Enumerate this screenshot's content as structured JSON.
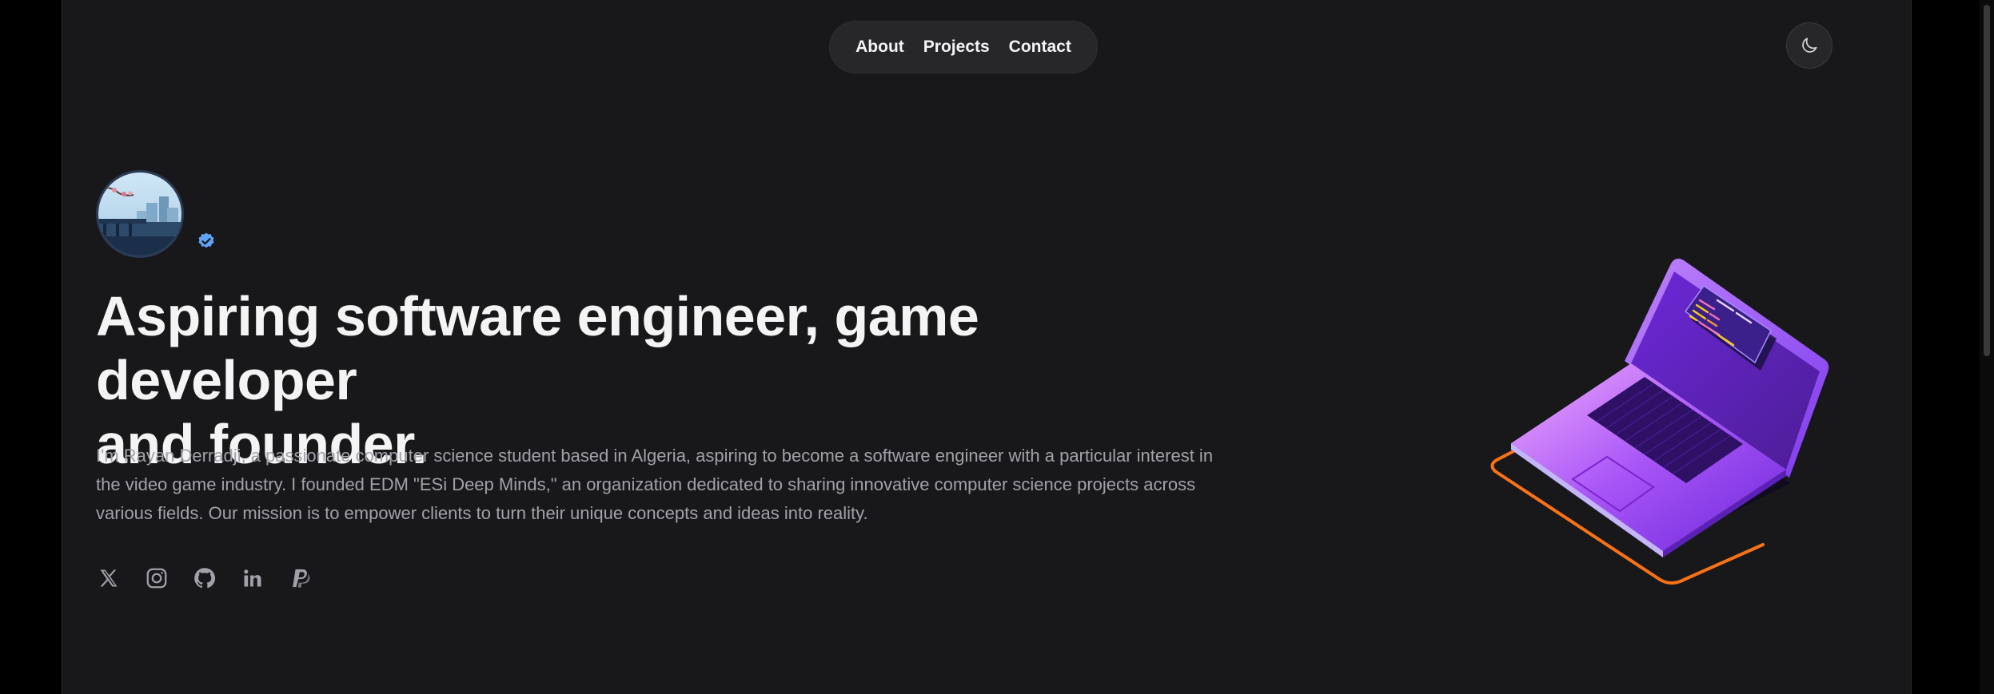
{
  "nav": {
    "items": [
      {
        "label": "About"
      },
      {
        "label": "Projects"
      },
      {
        "label": "Contact"
      }
    ]
  },
  "theme_toggle": {
    "icon": "moon-icon"
  },
  "hero": {
    "headline_line1": "Aspiring software engineer, game developer",
    "headline_line2": "and founder.",
    "bio": "I'm Rayan Derradji, a passionate computer science student based in Algeria, aspiring to become a software engineer with a particular interest in the video game industry. I founded EDM \"ESi Deep Minds,\" an organization dedicated to sharing innovative computer science projects across various fields. Our mission is to empower clients to turn their unique concepts and ideas into reality."
  },
  "socials": [
    "x-icon",
    "instagram-icon",
    "github-icon",
    "linkedin-icon",
    "paypal-icon"
  ],
  "colors": {
    "background": "#18181b",
    "nav_bg": "#27272a",
    "text_primary": "#f4f4f5",
    "text_secondary": "#a1a1aa",
    "verified": "#60a5fa",
    "laptop_purple": "#7c3aed",
    "laptop_orange": "#f97316"
  }
}
